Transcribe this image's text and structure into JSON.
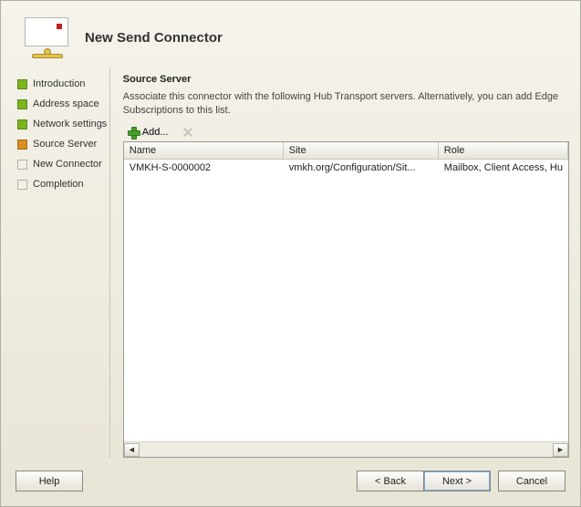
{
  "header": {
    "title": "New Send Connector"
  },
  "steps": [
    {
      "label": "Introduction",
      "state": "done"
    },
    {
      "label": "Address space",
      "state": "done"
    },
    {
      "label": "Network settings",
      "state": "done"
    },
    {
      "label": "Source Server",
      "state": "current"
    },
    {
      "label": "New Connector",
      "state": "future"
    },
    {
      "label": "Completion",
      "state": "future"
    }
  ],
  "main": {
    "section_title": "Source Server",
    "description": "Associate this connector with the following Hub Transport servers. Alternatively, you can add Edge Subscriptions to this list.",
    "add_label": "Add...",
    "columns": {
      "name": "Name",
      "site": "Site",
      "role": "Role"
    },
    "rows": [
      {
        "name": "VMKH-S-0000002",
        "site": "vmkh.org/Configuration/Sit...",
        "role": "Mailbox, Client Access, Hu"
      }
    ]
  },
  "buttons": {
    "help": "Help",
    "back": "< Back",
    "next": "Next >",
    "cancel": "Cancel"
  }
}
